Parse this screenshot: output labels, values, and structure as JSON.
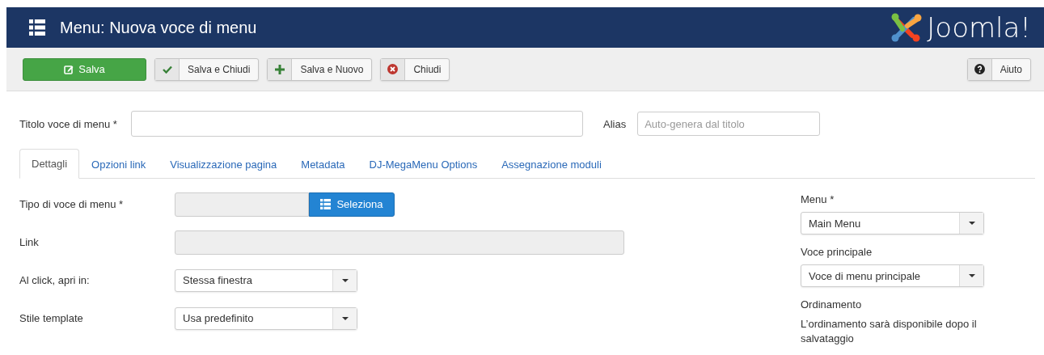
{
  "header": {
    "title": "Menu: Nuova voce di menu",
    "logo": "Joomla!"
  },
  "toolbar": {
    "buttons": [
      {
        "kind": "primary",
        "label": "Salva"
      },
      {
        "kind": "check",
        "label": "Salva e Chiudi"
      },
      {
        "kind": "plus",
        "label": "Salva e Nuovo"
      },
      {
        "kind": "close",
        "label": "Chiudi"
      }
    ],
    "help_button": {
      "kind": "help",
      "label": "Aiuto"
    }
  },
  "title_row": {
    "title_label": "Titolo voce di menu *",
    "alias_label": "Alias",
    "alias_placeholder": "Auto-genera dal titolo"
  },
  "tabs": [
    {
      "label": "Dettagli",
      "selected": true
    },
    {
      "label": "Opzioni link",
      "selected": false
    },
    {
      "label": "Visualizzazione pagina",
      "selected": false
    },
    {
      "label": "Metadata",
      "selected": false
    },
    {
      "label": "DJ-MegaMenu Options",
      "selected": false
    },
    {
      "label": "Assegnazione moduli",
      "selected": false
    }
  ],
  "details": [
    {
      "kind": "picker",
      "label": "Tipo di voce di menu *",
      "button": "Seleziona"
    },
    {
      "kind": "readonly",
      "label": "Link"
    },
    {
      "kind": "select",
      "label": "Al click, apri in:",
      "value": "Stessa finestra"
    },
    {
      "kind": "select",
      "label": "Stile template",
      "value": "Usa predefinito"
    }
  ],
  "sidebar": [
    {
      "kind": "select",
      "label": "Menu *",
      "value": "Main Menu"
    },
    {
      "kind": "select",
      "label": "Voce principale",
      "value": "Voce di menu principale"
    },
    {
      "kind": "note",
      "label": "Ordinamento",
      "text": "L’ordinamento sarà disponibile dopo il salvataggio"
    }
  ]
}
